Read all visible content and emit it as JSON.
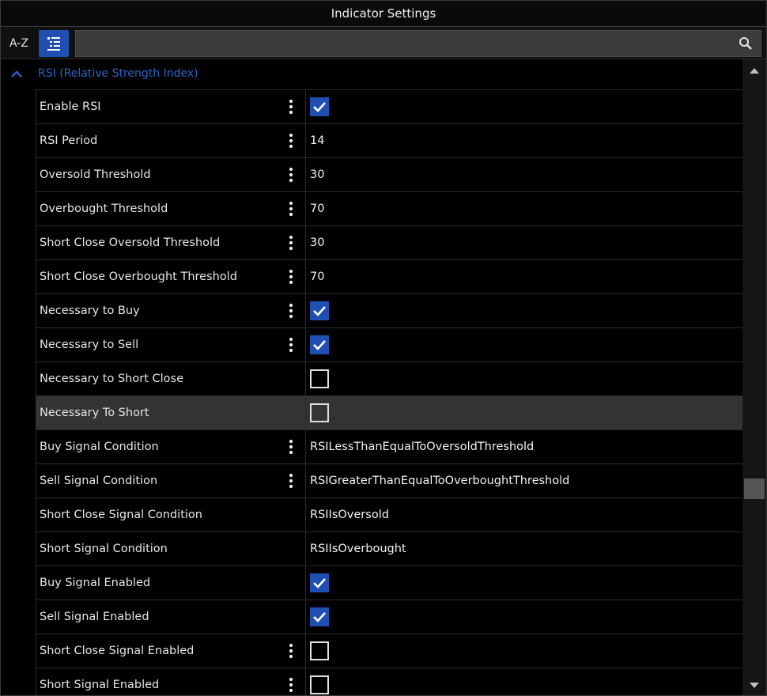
{
  "window": {
    "title": "Indicator Settings"
  },
  "toolbar": {
    "az_label": "A-Z",
    "search_placeholder": ""
  },
  "group": {
    "title": "RSI (Relative Strength Index)"
  },
  "colors": {
    "accent": "#1f4fb0",
    "group_text": "#2a63c9",
    "highlight_row": "#333333"
  },
  "rows": [
    {
      "name": "Enable RSI",
      "kind": "check",
      "checked": true,
      "menu": true
    },
    {
      "name": "RSI Period",
      "kind": "text",
      "value": "14",
      "menu": true
    },
    {
      "name": "Oversold Threshold",
      "kind": "text",
      "value": "30",
      "menu": true
    },
    {
      "name": "Overbought Threshold",
      "kind": "text",
      "value": "70",
      "menu": true
    },
    {
      "name": "Short Close Oversold Threshold",
      "kind": "text",
      "value": "30",
      "menu": true
    },
    {
      "name": "Short Close Overbought Threshold",
      "kind": "text",
      "value": "70",
      "menu": true
    },
    {
      "name": "Necessary to Buy",
      "kind": "check",
      "checked": true,
      "menu": true
    },
    {
      "name": "Necessary to Sell",
      "kind": "check",
      "checked": true,
      "menu": true
    },
    {
      "name": "Necessary to Short Close",
      "kind": "check",
      "checked": false,
      "menu": false
    },
    {
      "name": "Necessary To Short",
      "kind": "check",
      "checked": false,
      "menu": false,
      "highlight": true
    },
    {
      "name": "Buy Signal Condition",
      "kind": "text",
      "value": "RSILessThanEqualToOversoldThreshold",
      "menu": true
    },
    {
      "name": "Sell Signal Condition",
      "kind": "text",
      "value": "RSIGreaterThanEqualToOverboughtThreshold",
      "menu": true
    },
    {
      "name": "Short Close Signal Condition",
      "kind": "text",
      "value": "RSIIsOversold",
      "menu": false
    },
    {
      "name": "Short Signal Condition",
      "kind": "text",
      "value": "RSIIsOverbought",
      "menu": false
    },
    {
      "name": "Buy Signal Enabled",
      "kind": "check",
      "checked": true,
      "menu": false
    },
    {
      "name": "Sell Signal Enabled",
      "kind": "check",
      "checked": true,
      "menu": false
    },
    {
      "name": "Short Close Signal Enabled",
      "kind": "check",
      "checked": false,
      "menu": true
    },
    {
      "name": "Short Signal Enabled",
      "kind": "check",
      "checked": false,
      "menu": true
    }
  ]
}
